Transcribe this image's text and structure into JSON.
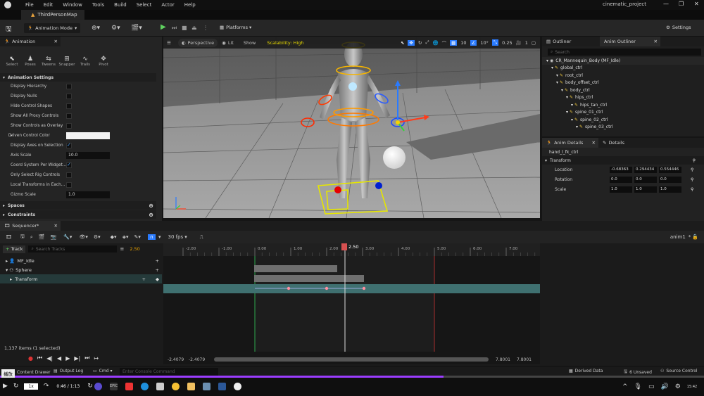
{
  "app": {
    "project_name": "cinematic_project",
    "level_tab": "ThirdPersonMap",
    "menus": [
      "File",
      "Edit",
      "Window",
      "Tools",
      "Build",
      "Select",
      "Actor",
      "Help"
    ]
  },
  "toolbar": {
    "mode": "Animation Mode",
    "platforms": "Platforms",
    "settings": "Settings"
  },
  "animation_panel": {
    "title": "Animation",
    "tools": [
      "Select",
      "Poses",
      "Tweens",
      "Snapper",
      "Trails",
      "Pivot"
    ],
    "section_title": "Animation Settings",
    "props": [
      {
        "label": "Display Hierarchy",
        "type": "check",
        "on": false
      },
      {
        "label": "Display Nulls",
        "type": "check",
        "on": false
      },
      {
        "label": "Hide Control Shapes",
        "type": "check",
        "on": false
      },
      {
        "label": "Show All Proxy Controls",
        "type": "check",
        "on": false
      },
      {
        "label": "Show Controls as Overlay",
        "type": "check",
        "on": false
      },
      {
        "label": "Driven Control Color",
        "type": "color",
        "on": false
      },
      {
        "label": "Display Axes on Selection",
        "type": "check",
        "on": true
      },
      {
        "label": "Axis Scale",
        "type": "value",
        "value": "10.0"
      },
      {
        "label": "Coord System Per Widget...",
        "type": "check",
        "on": true
      },
      {
        "label": "Only Select Rig Controls",
        "type": "check",
        "on": false
      },
      {
        "label": "Local Transforms in Each...",
        "type": "check",
        "on": false
      },
      {
        "label": "Gizmo Scale",
        "type": "value",
        "value": "1.0"
      }
    ],
    "spaces": "Spaces",
    "constraints": "Constraints"
  },
  "viewport": {
    "perspective": "Perspective",
    "lit": "Lit",
    "show": "Show",
    "scalability": "Scalability: High",
    "grid_size": "10",
    "angle": "10°",
    "scale": "0.25",
    "cam_speed": "1"
  },
  "outliner": {
    "tab1": "Outliner",
    "tab2": "Anim Outliner",
    "search_placeholder": "Search",
    "items": [
      {
        "label": "CR_Mannequin_Body (MF_Idle)",
        "depth": 0
      },
      {
        "label": "global_ctrl",
        "depth": 1
      },
      {
        "label": "root_ctrl",
        "depth": 2
      },
      {
        "label": "body_offset_ctrl",
        "depth": 2
      },
      {
        "label": "body_ctrl",
        "depth": 3
      },
      {
        "label": "hips_ctrl",
        "depth": 4
      },
      {
        "label": "hips_tan_ctrl",
        "depth": 5
      },
      {
        "label": "spine_01_ctrl",
        "depth": 4
      },
      {
        "label": "spine_02_ctrl",
        "depth": 5
      },
      {
        "label": "spine_03_ctrl",
        "depth": 6
      }
    ]
  },
  "details": {
    "tab1": "Anim Details",
    "tab2": "Details",
    "control": "hand_l_fk_ctrl",
    "section": "Transform",
    "rows": [
      {
        "label": "Location",
        "x": "-0.68363",
        "y": "0.294434",
        "z": "0.554446"
      },
      {
        "label": "Rotation",
        "x": "0.0",
        "y": "0.0",
        "z": "0.0"
      },
      {
        "label": "Scale",
        "x": "1.0",
        "y": "1.0",
        "z": "1.0"
      }
    ]
  },
  "sequencer": {
    "title": "Sequencer",
    "fps": "30 fps",
    "seq_name": "anim1",
    "add_track": "Track",
    "search_placeholder": "Search Tracks",
    "current_time": "2.50",
    "tracks": [
      "MF_Idle",
      "Sphere",
      "Transform"
    ],
    "ruler_labels": [
      "-2.00",
      "-1.00",
      "0.00",
      "1.00",
      "2.00",
      "3.00",
      "4.00",
      "5.00",
      "6.00",
      "7.00"
    ],
    "items_count": "1,137 items (1 selected)",
    "range_start": "-2.4079",
    "range_start2": "-2.4079",
    "range_end": "7.8001",
    "range_end2": "7.8001"
  },
  "statusbar": {
    "content_drawer": "Content Drawer",
    "output_log": "Output Log",
    "cmd": "Cmd",
    "console_placeholder": "Enter Console Command",
    "derived_data": "Derived Data",
    "unsaved": "6 Unsaved",
    "source_control": "Source Control"
  },
  "player": {
    "tooltip": "播放",
    "speed": "1x",
    "time": "0:46 / 1:13",
    "progress": 0.63,
    "clock": "15:42"
  }
}
